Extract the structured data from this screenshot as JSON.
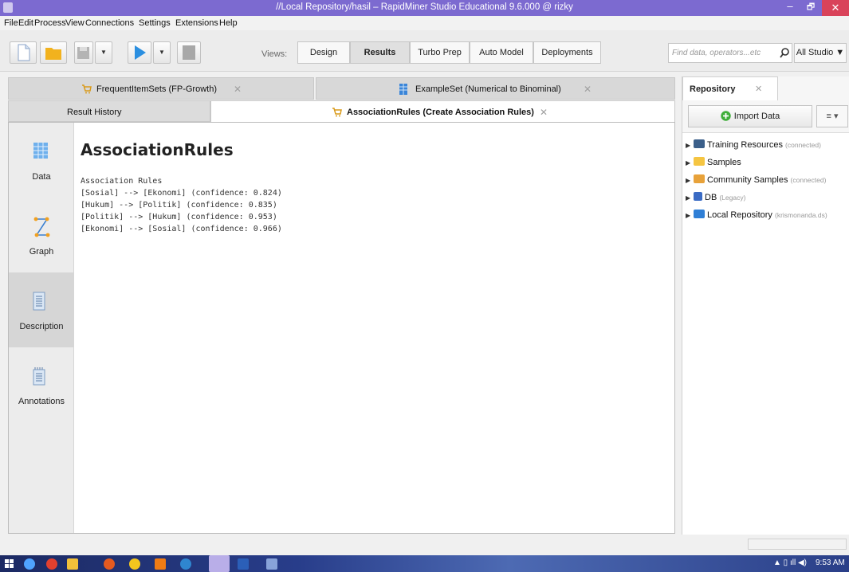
{
  "window": {
    "title": "//Local Repository/hasil – RapidMiner Studio Educational 9.6.000 @ rizky",
    "minimize": "–",
    "maximize": "🗗",
    "close": "✕"
  },
  "menu": [
    "File",
    "Edit",
    "Process",
    "View",
    "Connections",
    "Settings",
    "Extensions",
    "Help"
  ],
  "toolbar": {
    "views_label": "Views:",
    "views": [
      "Design",
      "Results",
      "Turbo Prep",
      "Auto Model",
      "Deployments"
    ],
    "active_view": "Results",
    "search_placeholder": "Find data, operators...etc",
    "studio_label": "All Studio ▼"
  },
  "tabs_row1": [
    {
      "label": "FrequentItemSets (FP-Growth)",
      "icon": "cart-icon"
    },
    {
      "label": "ExampleSet (Numerical to Binominal)",
      "icon": "table-icon"
    }
  ],
  "tabs_row2": [
    {
      "label": "Result History"
    },
    {
      "label": "AssociationRules (Create Association Rules)",
      "icon": "cart-icon"
    }
  ],
  "close_glyph": "✕",
  "sidebar": {
    "items": [
      {
        "label": "Data",
        "icon": "table-grid-icon"
      },
      {
        "label": "Graph",
        "icon": "graph-icon"
      },
      {
        "label": "Description",
        "icon": "document-icon"
      },
      {
        "label": "Annotations",
        "icon": "notepad-icon"
      }
    ],
    "active": "Description"
  },
  "content": {
    "heading": "AssociationRules",
    "rules_title": "Association Rules",
    "rules": [
      "[Sosial] --> [Ekonomi] (confidence: 0.824)",
      "[Hukum] --> [Politik] (confidence: 0.835)",
      "[Politik] --> [Hukum] (confidence: 0.953)",
      "[Ekonomi] --> [Sosial] (confidence: 0.966)"
    ]
  },
  "repository": {
    "tab_label": "Repository",
    "import_label": "Import Data",
    "menu_label": "≡ ▾",
    "tree": [
      {
        "label": "Training Resources",
        "sub": "(connected)",
        "icon_color": "#3b5f8a"
      },
      {
        "label": "Samples",
        "sub": "",
        "icon_color": "#f5c542"
      },
      {
        "label": "Community Samples",
        "sub": "(connected)",
        "icon_color": "#e8a23a"
      },
      {
        "label": "DB",
        "sub": "(Legacy)",
        "icon_color": "#3a6bc4"
      },
      {
        "label": "Local Repository",
        "sub": "(krismonanda.ds)",
        "icon_color": "#2f7fd6"
      }
    ]
  },
  "taskbar": {
    "time": "9:53 AM"
  }
}
